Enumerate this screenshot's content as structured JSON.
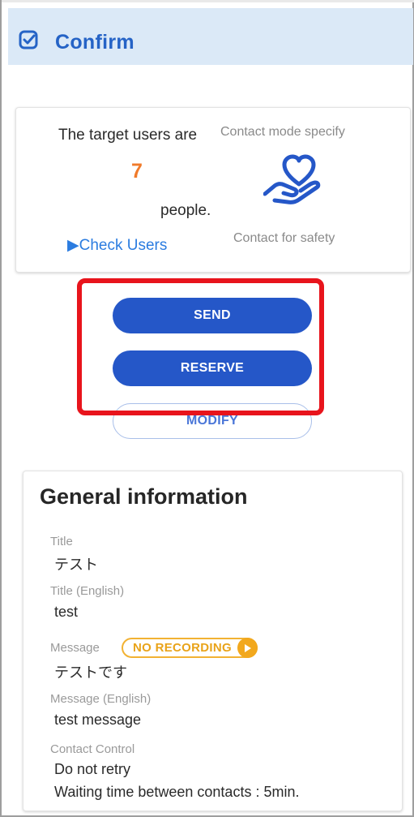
{
  "header": {
    "title": "Confirm",
    "icon": "confirm-check-icon"
  },
  "target": {
    "prefix": "The target users are",
    "count": "7",
    "suffix": "people.",
    "check_users_label": "▶Check Users"
  },
  "contact_mode": {
    "label": "Contact mode specify",
    "icon": "heart-hand-icon",
    "value": "Contact for safety"
  },
  "actions": {
    "send_label": "SEND",
    "reserve_label": "RESERVE",
    "modify_label": "MODIFY"
  },
  "general": {
    "heading": "General information",
    "title_label": "Title",
    "title_value": "テスト",
    "title_en_label": "Title (English)",
    "title_en_value": "test",
    "message_label": "Message",
    "recording_badge": "NO RECORDING",
    "message_value": "テストです",
    "message_en_label": "Message (English)",
    "message_en_value": "test message",
    "contact_control_label": "Contact Control",
    "retry_value": "Do not retry",
    "waiting_value": "Waiting time between contacts : 5min."
  },
  "colors": {
    "accent": "#2557c8",
    "header_bg": "#dbe9f7",
    "count": "#f07a2a",
    "link": "#2b7ce0",
    "highlight": "#e8141c",
    "badge": "#f2b233"
  }
}
